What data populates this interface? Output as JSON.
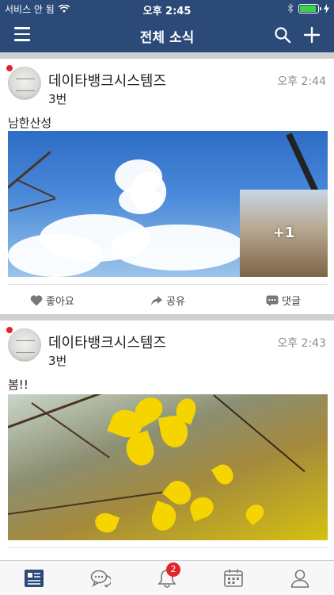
{
  "status_bar": {
    "carrier": "서비스 안 됨",
    "time": "오후 2:45"
  },
  "nav": {
    "title": "전체 소식",
    "menu_icon": "hamburger-menu-icon",
    "search_icon": "search-icon",
    "add_icon": "plus-icon"
  },
  "posts": [
    {
      "author": "데이타뱅크시스템즈",
      "subtitle": "3번",
      "time": "오후 2:44",
      "text": "남한산성",
      "more_photos": "+1",
      "actions": {
        "like": "좋아요",
        "share": "공유",
        "comment": "댓글"
      }
    },
    {
      "author": "데이타뱅크시스템즈",
      "subtitle": "3번",
      "time": "오후 2:43",
      "text": "봄!!"
    }
  ],
  "tabbar": {
    "notification_badge": "2",
    "items": [
      "feed-icon",
      "chat-icon",
      "bell-icon",
      "calendar-icon",
      "profile-icon"
    ]
  },
  "colors": {
    "header": "#2b4a78",
    "unread_dot": "#e0262b",
    "battery": "#3bd14a"
  }
}
